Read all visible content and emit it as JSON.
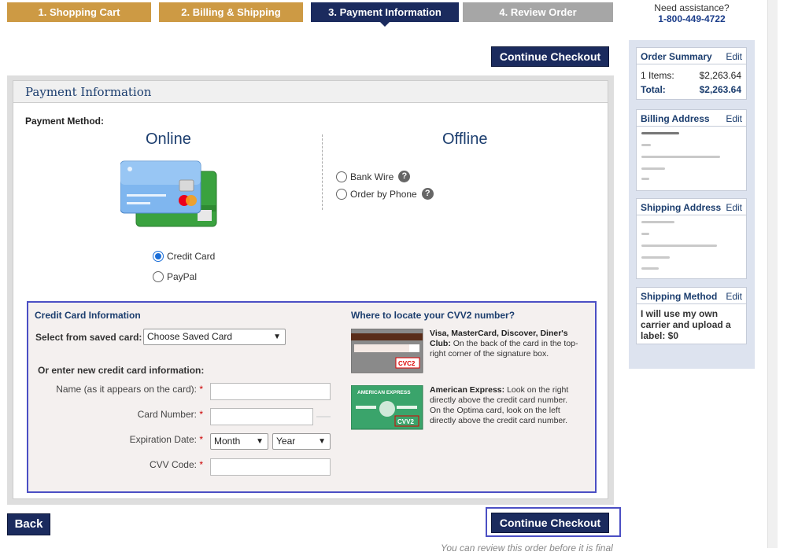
{
  "steps": [
    {
      "label": "1. Shopping Cart"
    },
    {
      "label": "2. Billing & Shipping"
    },
    {
      "label": "3. Payment Information"
    },
    {
      "label": "4. Review Order"
    }
  ],
  "assistance": {
    "question": "Need assistance?",
    "phone": "1-800-449-4722"
  },
  "continue_label": "Continue Checkout",
  "back_label": "Back",
  "panel": {
    "title": "Payment Information",
    "method_label": "Payment Method:",
    "online_title": "Online",
    "offline_title": "Offline",
    "online_options": [
      "Credit Card",
      "PayPal"
    ],
    "offline_options": [
      "Bank Wire",
      "Order by Phone"
    ],
    "selected": "Credit Card"
  },
  "credit_card": {
    "title": "Credit Card Information",
    "saved_label": "Select from saved card:",
    "saved_value": "Choose Saved Card",
    "new_label": "Or enter new credit card information:",
    "name_label": "Name (as it appears on the card):",
    "number_label": "Card Number:",
    "expiration_label": "Expiration Date:",
    "month_value": "Month",
    "year_value": "Year",
    "cvv_label": "CVV Code:",
    "required_mark": "*"
  },
  "cvv_help": {
    "title": "Where to locate your CVV2 number?",
    "visa_bold": "Visa, MasterCard, Discover, Diner's Club:",
    "visa_text": "On the back of the card in the top-right corner of the signature box.",
    "amex_bold": "American Express:",
    "amex_text": "Look on the right directly above the credit card number. On the Optima card, look on the left directly above the credit card number.",
    "visa_card_label": "CVC2",
    "amex_card_brand": "AMERICAN EXPRESS",
    "amex_card_label": "CVV2"
  },
  "sidebar": {
    "order_summary": {
      "title": "Order Summary",
      "edit": "Edit",
      "items_label": "1 Items:",
      "items_value": "$2,263.64",
      "total_label": "Total:",
      "total_value": "$2,263.64"
    },
    "billing": {
      "title": "Billing Address",
      "edit": "Edit"
    },
    "shipping": {
      "title": "Shipping Address",
      "edit": "Edit"
    },
    "method": {
      "title": "Shipping Method",
      "edit": "Edit",
      "text": "I will use my own carrier and upload a label: $0"
    }
  },
  "footer_note": "You can review this order before it is final",
  "colors": {
    "step_done": "#cd9a44",
    "step_active": "#1b2b5e",
    "step_todo": "#a6a6a6",
    "highlight": "#4b4fc4"
  }
}
